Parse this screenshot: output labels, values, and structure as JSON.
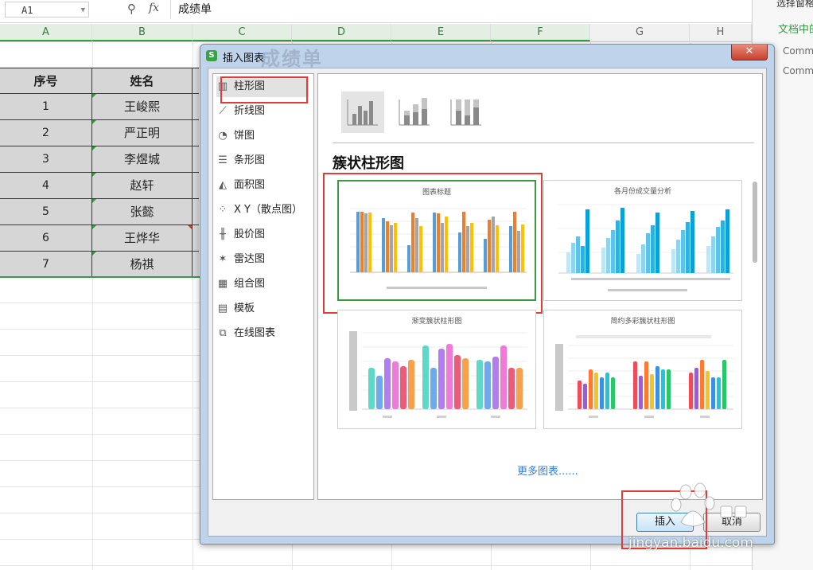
{
  "formula_bar": {
    "cell_ref": "A1",
    "fx": "fx",
    "value": "成绩单"
  },
  "columns": [
    "A",
    "B",
    "C",
    "D",
    "E",
    "F",
    "G",
    "H"
  ],
  "table": {
    "headers": [
      "序号",
      "姓名"
    ],
    "rows": [
      [
        "1",
        "王峻熙"
      ],
      [
        "2",
        "严正明"
      ],
      [
        "3",
        "李煜城"
      ],
      [
        "4",
        "赵轩"
      ],
      [
        "5",
        "张懿"
      ],
      [
        "6",
        "王烨华"
      ],
      [
        "7",
        "杨祺"
      ]
    ]
  },
  "right_pane": {
    "top_text": "选择窗格",
    "doc_label": "文档中的",
    "items": [
      "Comm",
      "Comm"
    ]
  },
  "dialog": {
    "title": "插入图表",
    "ghost_text": "成绩单",
    "close": "✕",
    "chart_types": [
      {
        "label": "柱形图",
        "icon": "column-chart-icon",
        "glyph": "▥"
      },
      {
        "label": "折线图",
        "icon": "line-chart-icon",
        "glyph": "⟋"
      },
      {
        "label": "饼图",
        "icon": "pie-chart-icon",
        "glyph": "◔"
      },
      {
        "label": "条形图",
        "icon": "bar-chart-icon",
        "glyph": "☰"
      },
      {
        "label": "面积图",
        "icon": "area-chart-icon",
        "glyph": "◭"
      },
      {
        "label": "X Y（散点图）",
        "icon": "scatter-chart-icon",
        "glyph": "⁘"
      },
      {
        "label": "股价图",
        "icon": "stock-chart-icon",
        "glyph": "╫"
      },
      {
        "label": "雷达图",
        "icon": "radar-chart-icon",
        "glyph": "✶"
      },
      {
        "label": "组合图",
        "icon": "combo-chart-icon",
        "glyph": "▦"
      },
      {
        "label": "模板",
        "icon": "template-icon",
        "glyph": "▤"
      },
      {
        "label": "在线图表",
        "icon": "online-chart-icon",
        "glyph": "⧉"
      }
    ],
    "subtype_title": "簇状柱形图",
    "previews": [
      {
        "title": "图表标题"
      },
      {
        "title": "各月份成交量分析"
      },
      {
        "title": "渐变簇状柱形图"
      },
      {
        "title": "简约多彩簇状柱形图"
      }
    ],
    "more_charts": "更多图表......",
    "ok_label": "插入",
    "cancel_label": "取消"
  },
  "watermark": "jingyan.baidu.com",
  "colors": {
    "accent_green": "#3a9a45",
    "highlight_red": "#e03c3c",
    "dialog_frame": "#bfd3ea"
  }
}
